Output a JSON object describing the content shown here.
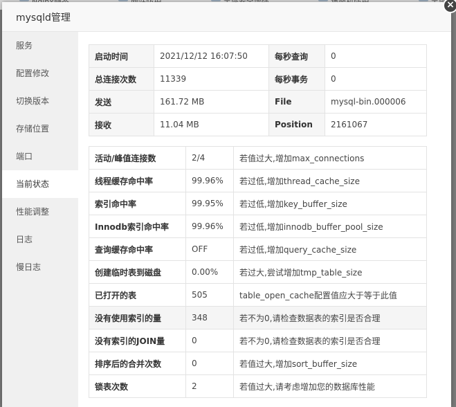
{
  "background": {
    "tabs": [
      "Nginx静态",
      "网站防护",
      "宝塔安全增强",
      "堡垒机防护",
      "宝塔系统"
    ]
  },
  "dialog": {
    "title": "mysqld管理",
    "close_label": "×"
  },
  "sidebar": {
    "items": [
      {
        "label": "服务",
        "active": false
      },
      {
        "label": "配置修改",
        "active": false
      },
      {
        "label": "切换版本",
        "active": false
      },
      {
        "label": "存储位置",
        "active": false
      },
      {
        "label": "端口",
        "active": false
      },
      {
        "label": "当前状态",
        "active": true
      },
      {
        "label": "性能调整",
        "active": false
      },
      {
        "label": "日志",
        "active": false
      },
      {
        "label": "慢日志",
        "active": false
      }
    ]
  },
  "status": {
    "rows": [
      {
        "label1": "启动时间",
        "value1": "2021/12/12 16:07:50",
        "label2": "每秒查询",
        "value2": "0"
      },
      {
        "label1": "总连接次数",
        "value1": "11339",
        "label2": "每秒事务",
        "value2": "0"
      },
      {
        "label1": "发送",
        "value1": "161.72 MB",
        "label2": "File",
        "value2": "mysql-bin.000006"
      },
      {
        "label1": "接收",
        "value1": "11.04 MB",
        "label2": "Position",
        "value2": "2161067"
      }
    ]
  },
  "performance": {
    "rows": [
      {
        "name": "活动/峰值连接数",
        "value": "2/4",
        "advice": "若值过大,增加max_connections",
        "highlight": false
      },
      {
        "name": "线程缓存命中率",
        "value": "99.96%",
        "advice": "若过低,增加thread_cache_size",
        "highlight": false
      },
      {
        "name": "索引命中率",
        "value": "99.95%",
        "advice": "若过低,增加key_buffer_size",
        "highlight": false
      },
      {
        "name": "Innodb索引命中率",
        "value": "99.96%",
        "advice": "若过低,增加innodb_buffer_pool_size",
        "highlight": false
      },
      {
        "name": "查询缓存命中率",
        "value": "OFF",
        "advice": "若过低,增加query_cache_size",
        "highlight": false
      },
      {
        "name": "创建临时表到磁盘",
        "value": "0.00%",
        "advice": "若过大,尝试增加tmp_table_size",
        "highlight": false
      },
      {
        "name": "已打开的表",
        "value": "505",
        "advice": "table_open_cache配置值应大于等于此值",
        "highlight": false
      },
      {
        "name": "没有使用索引的量",
        "value": "348",
        "advice": "若不为0,请检查数据表的索引是否合理",
        "highlight": true
      },
      {
        "name": "没有索引的JOIN量",
        "value": "0",
        "advice": "若不为0,请检查数据表的索引是否合理",
        "highlight": false
      },
      {
        "name": "排序后的合并次数",
        "value": "0",
        "advice": "若值过大,增加sort_buffer_size",
        "highlight": false
      },
      {
        "name": "锁表次数",
        "value": "2",
        "advice": "若值过大,请考虑增加您的数据库性能",
        "highlight": false
      }
    ]
  }
}
